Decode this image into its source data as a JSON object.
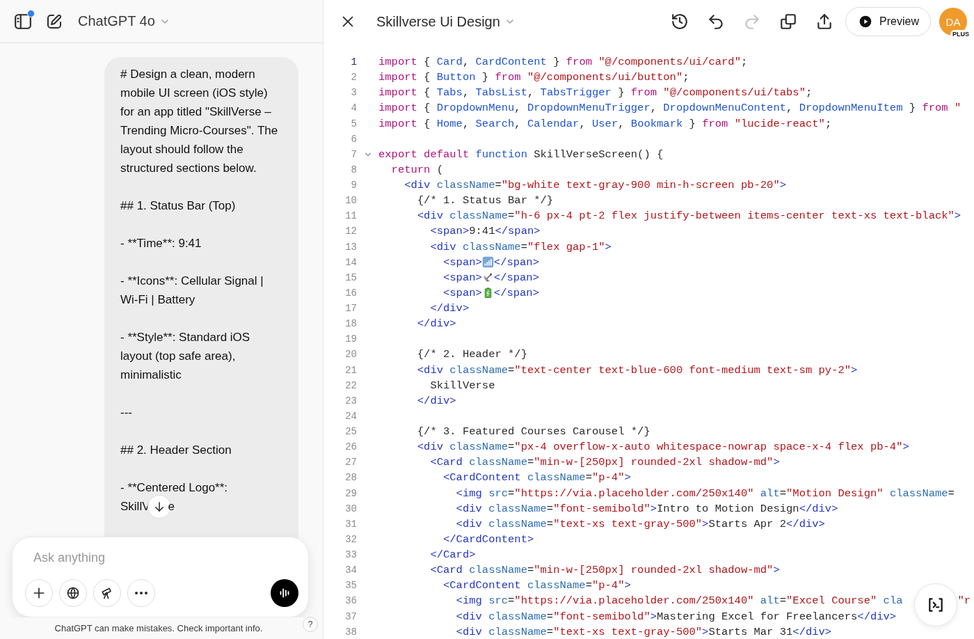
{
  "sidebar_header": {
    "model": "ChatGPT 4o",
    "notification_dot": true
  },
  "message": {
    "paragraphs": [
      "# Design a clean, modern mobile UI screen (iOS style) for an app titled \"SkillVerse – Trending Micro-Courses\". The layout should follow the structured sections below.",
      "## 1. Status Bar (Top)",
      "- **Time**: 9:41",
      "- **Icons**: Cellular Signal | Wi-Fi | Battery",
      "- **Style**: Standard iOS layout (top safe area), minimalistic",
      "---",
      "## 2. Header Section",
      "- **Centered Logo**:"
    ],
    "cut_line": {
      "before": "SkillV",
      "after": "e"
    }
  },
  "composer": {
    "placeholder": "Ask anything"
  },
  "disclaimer": "ChatGPT can make mistakes. Check important info.",
  "help": "?",
  "canvas": {
    "title": "Skillverse Ui Design",
    "redo_disabled": true,
    "preview": "Preview",
    "avatar": "DA",
    "badge": "PLUS",
    "lines": [
      {
        "n": "1",
        "active": true,
        "fold": false,
        "tokens": [
          {
            "text": "import",
            "kind": "keyword"
          },
          {
            "text": " { ",
            "kind": "plain"
          },
          {
            "text": "Card",
            "kind": "name"
          },
          {
            "text": ", ",
            "kind": "plain"
          },
          {
            "text": "CardContent",
            "kind": "name"
          },
          {
            "text": " } ",
            "kind": "plain"
          },
          {
            "text": "from ",
            "kind": "keyword"
          },
          {
            "text": "\"@/components/ui/card\"",
            "kind": "string"
          },
          {
            "text": ";",
            "kind": "plain"
          }
        ]
      },
      {
        "n": "2",
        "active": false,
        "fold": false,
        "tokens": [
          {
            "text": "import",
            "kind": "keyword"
          },
          {
            "text": " { ",
            "kind": "plain"
          },
          {
            "text": "Button",
            "kind": "name"
          },
          {
            "text": " } ",
            "kind": "plain"
          },
          {
            "text": "from ",
            "kind": "keyword"
          },
          {
            "text": "\"@/components/ui/button\"",
            "kind": "string"
          },
          {
            "text": ";",
            "kind": "plain"
          }
        ]
      },
      {
        "n": "3",
        "active": false,
        "fold": false,
        "tokens": [
          {
            "text": "import",
            "kind": "keyword"
          },
          {
            "text": " { ",
            "kind": "plain"
          },
          {
            "text": "Tabs",
            "kind": "name"
          },
          {
            "text": ", ",
            "kind": "plain"
          },
          {
            "text": "TabsList",
            "kind": "name"
          },
          {
            "text": ", ",
            "kind": "plain"
          },
          {
            "text": "TabsTrigger",
            "kind": "name"
          },
          {
            "text": " } ",
            "kind": "plain"
          },
          {
            "text": "from ",
            "kind": "keyword"
          },
          {
            "text": "\"@/components/ui/tabs\"",
            "kind": "string"
          },
          {
            "text": ";",
            "kind": "plain"
          }
        ]
      },
      {
        "n": "4",
        "active": false,
        "fold": false,
        "tokens": [
          {
            "text": "import",
            "kind": "keyword"
          },
          {
            "text": " { ",
            "kind": "plain"
          },
          {
            "text": "DropdownMenu",
            "kind": "name"
          },
          {
            "text": ", ",
            "kind": "plain"
          },
          {
            "text": "DropdownMenuTrigger",
            "kind": "name"
          },
          {
            "text": ", ",
            "kind": "plain"
          },
          {
            "text": "DropdownMenuContent",
            "kind": "name"
          },
          {
            "text": ", ",
            "kind": "plain"
          },
          {
            "text": "DropdownMenuItem",
            "kind": "name"
          },
          {
            "text": " } ",
            "kind": "plain"
          },
          {
            "text": "from ",
            "kind": "keyword"
          },
          {
            "text": "\"",
            "kind": "string"
          }
        ]
      },
      {
        "n": "5",
        "active": false,
        "fold": false,
        "tokens": [
          {
            "text": "import",
            "kind": "keyword"
          },
          {
            "text": " { ",
            "kind": "plain"
          },
          {
            "text": "Home",
            "kind": "name"
          },
          {
            "text": ", ",
            "kind": "plain"
          },
          {
            "text": "Search",
            "kind": "name"
          },
          {
            "text": ", ",
            "kind": "plain"
          },
          {
            "text": "Calendar",
            "kind": "name"
          },
          {
            "text": ", ",
            "kind": "plain"
          },
          {
            "text": "User",
            "kind": "name"
          },
          {
            "text": ", ",
            "kind": "plain"
          },
          {
            "text": "Bookmark",
            "kind": "name"
          },
          {
            "text": " } ",
            "kind": "plain"
          },
          {
            "text": "from ",
            "kind": "keyword"
          },
          {
            "text": "\"lucide-react\"",
            "kind": "string"
          },
          {
            "text": ";",
            "kind": "plain"
          }
        ]
      },
      {
        "n": "6",
        "active": false,
        "fold": false
      },
      {
        "n": "7",
        "active": false,
        "fold": true,
        "tokens": [
          {
            "text": "export default ",
            "kind": "keyword"
          },
          {
            "text": "function",
            "kind": "name"
          },
          {
            "text": " SkillVerseScreen() {",
            "kind": "plain"
          }
        ]
      },
      {
        "n": "8",
        "active": false,
        "fold": false,
        "tokens": [
          {
            "text": "  return",
            "kind": "keyword"
          },
          {
            "text": " (",
            "kind": "plain"
          }
        ]
      },
      {
        "n": "9",
        "active": false,
        "fold": false,
        "tokens": [
          {
            "text": "    <div",
            "kind": "tag"
          },
          {
            "text": " className",
            "kind": "attr"
          },
          {
            "text": "=",
            "kind": "plain"
          },
          {
            "text": "\"bg-white text-gray-900 min-h-screen pb-20\"",
            "kind": "string"
          },
          {
            "text": ">",
            "kind": "tag"
          }
        ]
      },
      {
        "n": "10",
        "active": false,
        "fold": false,
        "tokens": [
          {
            "text": "      {/* 1. Status Bar */}",
            "kind": "plain"
          }
        ]
      },
      {
        "n": "11",
        "active": false,
        "fold": false,
        "tokens": [
          {
            "text": "      <div",
            "kind": "tag"
          },
          {
            "text": " className",
            "kind": "attr"
          },
          {
            "text": "=",
            "kind": "plain"
          },
          {
            "text": "\"h-6 px-4 pt-2 flex justify-between items-center text-xs text-black\"",
            "kind": "string"
          },
          {
            "text": ">",
            "kind": "tag"
          }
        ]
      },
      {
        "n": "12",
        "active": false,
        "fold": false,
        "tokens": [
          {
            "text": "        <span>",
            "kind": "tag"
          },
          {
            "text": "9:41",
            "kind": "plain"
          },
          {
            "text": "</span>",
            "kind": "tag"
          }
        ]
      },
      {
        "n": "13",
        "active": false,
        "fold": false,
        "tokens": [
          {
            "text": "        <div",
            "kind": "tag"
          },
          {
            "text": " className",
            "kind": "attr"
          },
          {
            "text": "=",
            "kind": "plain"
          },
          {
            "text": "\"flex gap-1\"",
            "kind": "string"
          },
          {
            "text": ">",
            "kind": "tag"
          }
        ]
      },
      {
        "n": "14",
        "active": false,
        "fold": false,
        "tokens": [
          {
            "text": "          <span>",
            "kind": "tag"
          },
          {
            "kind": "signal"
          },
          {
            "text": "</span>",
            "kind": "tag"
          }
        ]
      },
      {
        "n": "15",
        "active": false,
        "fold": false,
        "tokens": [
          {
            "text": "          <span>",
            "kind": "tag"
          },
          {
            "kind": "dish"
          },
          {
            "text": "</span>",
            "kind": "tag"
          }
        ]
      },
      {
        "n": "16",
        "active": false,
        "fold": false,
        "tokens": [
          {
            "text": "          <span>",
            "kind": "tag"
          },
          {
            "kind": "battery"
          },
          {
            "text": "</span>",
            "kind": "tag"
          }
        ]
      },
      {
        "n": "17",
        "active": false,
        "fold": false,
        "tokens": [
          {
            "text": "        </div>",
            "kind": "tag"
          }
        ]
      },
      {
        "n": "18",
        "active": false,
        "fold": false,
        "tokens": [
          {
            "text": "      </div>",
            "kind": "tag"
          }
        ]
      },
      {
        "n": "19",
        "active": false,
        "fold": false
      },
      {
        "n": "20",
        "active": false,
        "fold": false,
        "tokens": [
          {
            "text": "      {/* 2. Header */}",
            "kind": "plain"
          }
        ]
      },
      {
        "n": "21",
        "active": false,
        "fold": false,
        "tokens": [
          {
            "text": "      <div",
            "kind": "tag"
          },
          {
            "text": " className",
            "kind": "attr"
          },
          {
            "text": "=",
            "kind": "plain"
          },
          {
            "text": "\"text-center text-blue-600 font-medium text-sm py-2\"",
            "kind": "string"
          },
          {
            "text": ">",
            "kind": "tag"
          }
        ]
      },
      {
        "n": "22",
        "active": false,
        "fold": false,
        "tokens": [
          {
            "text": "        SkillVerse",
            "kind": "plain"
          }
        ]
      },
      {
        "n": "23",
        "active": false,
        "fold": false,
        "tokens": [
          {
            "text": "      </div>",
            "kind": "tag"
          }
        ]
      },
      {
        "n": "24",
        "active": false,
        "fold": false
      },
      {
        "n": "25",
        "active": false,
        "fold": false,
        "tokens": [
          {
            "text": "      {/* 3. Featured Courses Carousel */}",
            "kind": "plain"
          }
        ]
      },
      {
        "n": "26",
        "active": false,
        "fold": false,
        "tokens": [
          {
            "text": "      <div",
            "kind": "tag"
          },
          {
            "text": " className",
            "kind": "attr"
          },
          {
            "text": "=",
            "kind": "plain"
          },
          {
            "text": "\"px-4 overflow-x-auto whitespace-nowrap space-x-4 flex pb-4\"",
            "kind": "string"
          },
          {
            "text": ">",
            "kind": "tag"
          }
        ]
      },
      {
        "n": "27",
        "active": false,
        "fold": false,
        "tokens": [
          {
            "text": "        <Card",
            "kind": "tag"
          },
          {
            "text": " className",
            "kind": "attr"
          },
          {
            "text": "=",
            "kind": "plain"
          },
          {
            "text": "\"min-w-[250px] rounded-2xl shadow-md\"",
            "kind": "string"
          },
          {
            "text": ">",
            "kind": "tag"
          }
        ]
      },
      {
        "n": "28",
        "active": false,
        "fold": false,
        "tokens": [
          {
            "text": "          <CardContent",
            "kind": "tag"
          },
          {
            "text": " className",
            "kind": "attr"
          },
          {
            "text": "=",
            "kind": "plain"
          },
          {
            "text": "\"p-4\"",
            "kind": "string"
          },
          {
            "text": ">",
            "kind": "tag"
          }
        ]
      },
      {
        "n": "29",
        "active": false,
        "fold": false,
        "tokens": [
          {
            "text": "            <img",
            "kind": "tag"
          },
          {
            "text": " src",
            "kind": "attr"
          },
          {
            "text": "=",
            "kind": "plain"
          },
          {
            "text": "\"https://via.placeholder.com/250x140\"",
            "kind": "string"
          },
          {
            "text": " alt",
            "kind": "attr"
          },
          {
            "text": "=",
            "kind": "plain"
          },
          {
            "text": "\"Motion Design\"",
            "kind": "string"
          },
          {
            "text": " className",
            "kind": "attr"
          },
          {
            "text": "=",
            "kind": "plain"
          }
        ]
      },
      {
        "n": "30",
        "active": false,
        "fold": false,
        "tokens": [
          {
            "text": "            <div",
            "kind": "tag"
          },
          {
            "text": " className",
            "kind": "attr"
          },
          {
            "text": "=",
            "kind": "plain"
          },
          {
            "text": "\"font-semibold\"",
            "kind": "string"
          },
          {
            "text": ">",
            "kind": "tag"
          },
          {
            "text": "Intro to Motion Design",
            "kind": "plain"
          },
          {
            "text": "</div>",
            "kind": "tag"
          }
        ]
      },
      {
        "n": "31",
        "active": false,
        "fold": false,
        "tokens": [
          {
            "text": "            <div",
            "kind": "tag"
          },
          {
            "text": " className",
            "kind": "attr"
          },
          {
            "text": "=",
            "kind": "plain"
          },
          {
            "text": "\"text-xs text-gray-500\"",
            "kind": "string"
          },
          {
            "text": ">",
            "kind": "tag"
          },
          {
            "text": "Starts Apr 2",
            "kind": "plain"
          },
          {
            "text": "</div>",
            "kind": "tag"
          }
        ]
      },
      {
        "n": "32",
        "active": false,
        "fold": false,
        "tokens": [
          {
            "text": "          </CardContent>",
            "kind": "tag"
          }
        ]
      },
      {
        "n": "33",
        "active": false,
        "fold": false,
        "tokens": [
          {
            "text": "        </Card>",
            "kind": "tag"
          }
        ]
      },
      {
        "n": "34",
        "active": false,
        "fold": false,
        "tokens": [
          {
            "text": "        <Card",
            "kind": "tag"
          },
          {
            "text": " className",
            "kind": "attr"
          },
          {
            "text": "=",
            "kind": "plain"
          },
          {
            "text": "\"min-w-[250px] rounded-2xl shadow-md\"",
            "kind": "string"
          },
          {
            "text": ">",
            "kind": "tag"
          }
        ]
      },
      {
        "n": "35",
        "active": false,
        "fold": false,
        "tokens": [
          {
            "text": "          <CardContent",
            "kind": "tag"
          },
          {
            "text": " className",
            "kind": "attr"
          },
          {
            "text": "=",
            "kind": "plain"
          },
          {
            "text": "\"p-4\"",
            "kind": "string"
          },
          {
            "text": ">",
            "kind": "tag"
          }
        ]
      },
      {
        "n": "36",
        "active": false,
        "fold": false,
        "tokens": [
          {
            "text": "            <img",
            "kind": "tag"
          },
          {
            "text": " src",
            "kind": "attr"
          },
          {
            "text": "=",
            "kind": "plain"
          },
          {
            "text": "\"https://via.placeholder.com/250x140\"",
            "kind": "string"
          },
          {
            "text": " alt",
            "kind": "attr"
          },
          {
            "text": "=",
            "kind": "plain"
          },
          {
            "text": "\"Excel Course\"",
            "kind": "string"
          },
          {
            "text": " cla",
            "kind": "attr"
          },
          {
            "kind": "gap"
          },
          {
            "text": "\"r",
            "kind": "string"
          }
        ]
      },
      {
        "n": "37",
        "active": false,
        "fold": false,
        "tokens": [
          {
            "text": "            <div",
            "kind": "tag"
          },
          {
            "text": " className",
            "kind": "attr"
          },
          {
            "text": "=",
            "kind": "plain"
          },
          {
            "text": "\"font-semibold\"",
            "kind": "string"
          },
          {
            "text": ">",
            "kind": "tag"
          },
          {
            "text": "Mastering Excel for Freelancers",
            "kind": "plain"
          },
          {
            "text": "</div>",
            "kind": "tag"
          }
        ]
      },
      {
        "n": "38",
        "active": false,
        "fold": false,
        "tokens": [
          {
            "text": "            <div",
            "kind": "tag"
          },
          {
            "text": " className",
            "kind": "attr"
          },
          {
            "text": "=",
            "kind": "plain"
          },
          {
            "text": "\"text-xs text-gray-500\"",
            "kind": "string"
          },
          {
            "text": ">",
            "kind": "tag"
          },
          {
            "text": "Starts Mar 31",
            "kind": "plain"
          },
          {
            "text": "</div>",
            "kind": "tag"
          }
        ]
      }
    ]
  }
}
